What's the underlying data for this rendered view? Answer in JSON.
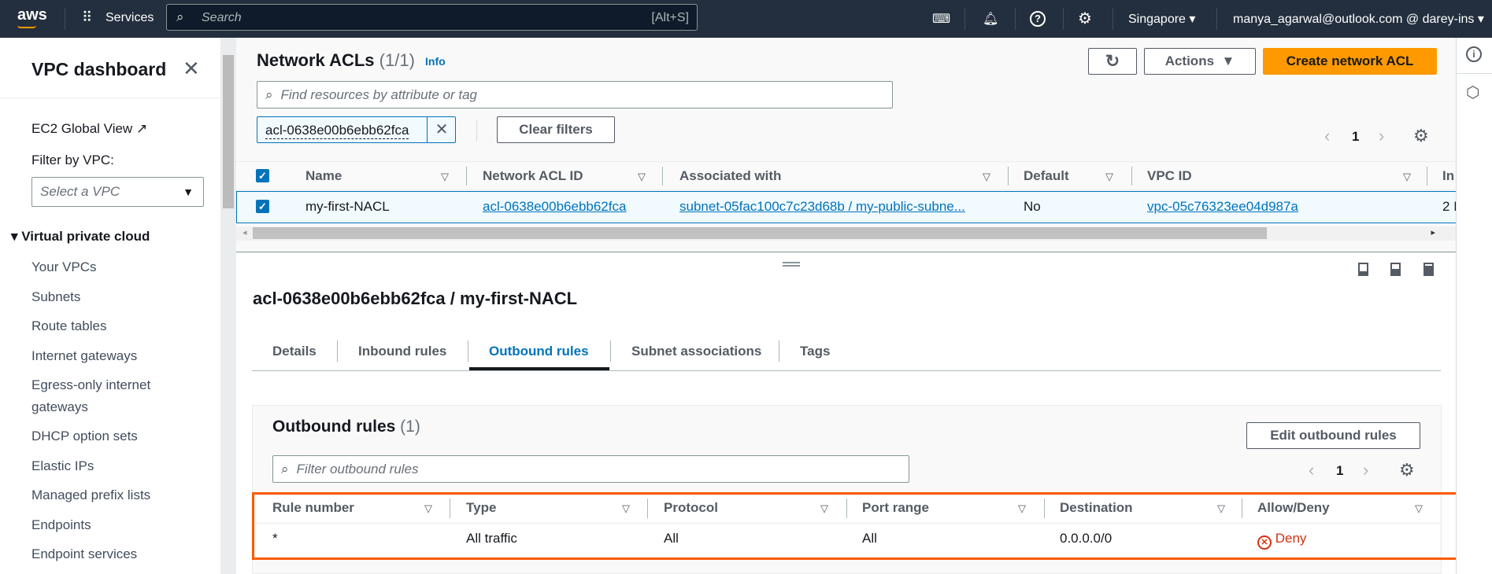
{
  "header": {
    "logo": "aws",
    "services": "Services",
    "search_placeholder": "Search",
    "search_shortcut": "[Alt+S]",
    "region": "Singapore",
    "account": "manya_agarwal@outlook.com @ darey-ins"
  },
  "sidebar": {
    "title": "VPC dashboard",
    "ec2_global_view": "EC2 Global View",
    "filter_label": "Filter by VPC:",
    "filter_placeholder": "Select a VPC",
    "section": "Virtual private cloud",
    "items": [
      "Your VPCs",
      "Subnets",
      "Route tables",
      "Internet gateways",
      "Egress-only internet",
      "gateways",
      "DHCP option sets",
      "Elastic IPs",
      "Managed prefix lists",
      "Endpoints",
      "Endpoint services"
    ]
  },
  "list": {
    "title": "Network ACLs",
    "count": "(1/1)",
    "info": "Info",
    "actions": "Actions",
    "create": "Create network ACL",
    "search_placeholder": "Find resources by attribute or tag",
    "filter_token": "acl-0638e00b6ebb62fca",
    "clear_filters": "Clear filters",
    "page": "1",
    "columns": [
      "Name",
      "Network ACL ID",
      "Associated with",
      "Default",
      "VPC ID",
      "In"
    ],
    "row": [
      "my-first-NACL",
      "acl-0638e00b6ebb62fca",
      "subnet-05fac100c7c23d68b / my-public-subne...",
      "No",
      "vpc-05c76323ee04d987a",
      "2 I"
    ]
  },
  "detail": {
    "title": "acl-0638e00b6ebb62fca / my-first-NACL",
    "tabs": [
      "Details",
      "Inbound rules",
      "Outbound rules",
      "Subnet associations",
      "Tags"
    ],
    "active_tab": "Outbound rules",
    "section_title": "Outbound rules",
    "section_count": "(1)",
    "edit": "Edit outbound rules",
    "filter_placeholder": "Filter outbound rules",
    "page": "1",
    "columns": [
      "Rule number",
      "Type",
      "Protocol",
      "Port range",
      "Destination",
      "Allow/Deny"
    ],
    "row": [
      "*",
      "All traffic",
      "All",
      "All",
      "0.0.0.0/0",
      "Deny"
    ]
  },
  "colors": {
    "header": "#232f3e",
    "primary": "#ff9900",
    "link": "#0073bb",
    "deny": "#d13212",
    "highlight": "#ff5a00"
  }
}
